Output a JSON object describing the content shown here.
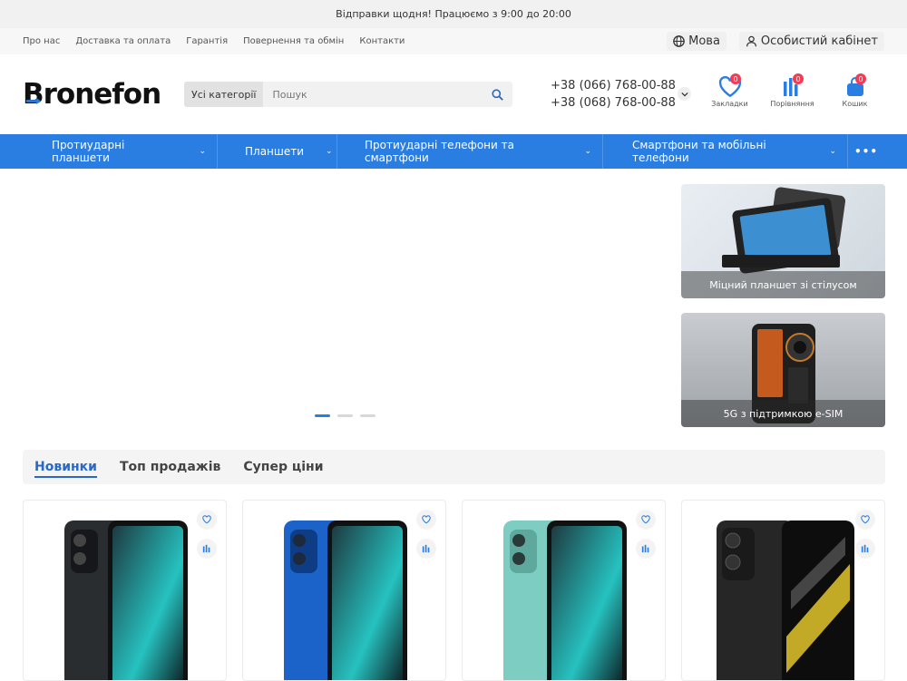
{
  "topbar": {
    "text": "Відправки щодня! Працюємо з 9:00 до 20:00"
  },
  "infobar": {
    "links": [
      "Про нас",
      "Доставка та оплата",
      "Гарантія",
      "Повернення та обмін",
      "Контакти"
    ],
    "language_label": "Мова",
    "account_label": "Особистий кабінет"
  },
  "header": {
    "logo": "Bronefon",
    "search_category": "Усі категорії",
    "search_placeholder": "Пошук",
    "phones": [
      "+38 (066) 768-00-88",
      "+38 (068) 768-00-88"
    ],
    "icons": [
      {
        "label": "Закладки",
        "count": "0"
      },
      {
        "label": "Порівняння",
        "count": "0"
      },
      {
        "label": "Кошик",
        "count": "0"
      }
    ]
  },
  "nav": {
    "items": [
      "Протиударні планшети",
      "Планшети",
      "Протиударні телефони та смартфони",
      "Смартфони та мобільні телефони"
    ],
    "more": "•••"
  },
  "banners": [
    {
      "caption": "Міцний планшет зі стілусом"
    },
    {
      "caption": "5G з підтримкою e-SIM"
    }
  ],
  "slider": {
    "dots": 3,
    "active": 0
  },
  "tabs": [
    "Новинки",
    "Топ продажів",
    "Супер ціни"
  ],
  "colors": {
    "accent": "#2a7de1",
    "badge": "#f23b55"
  }
}
